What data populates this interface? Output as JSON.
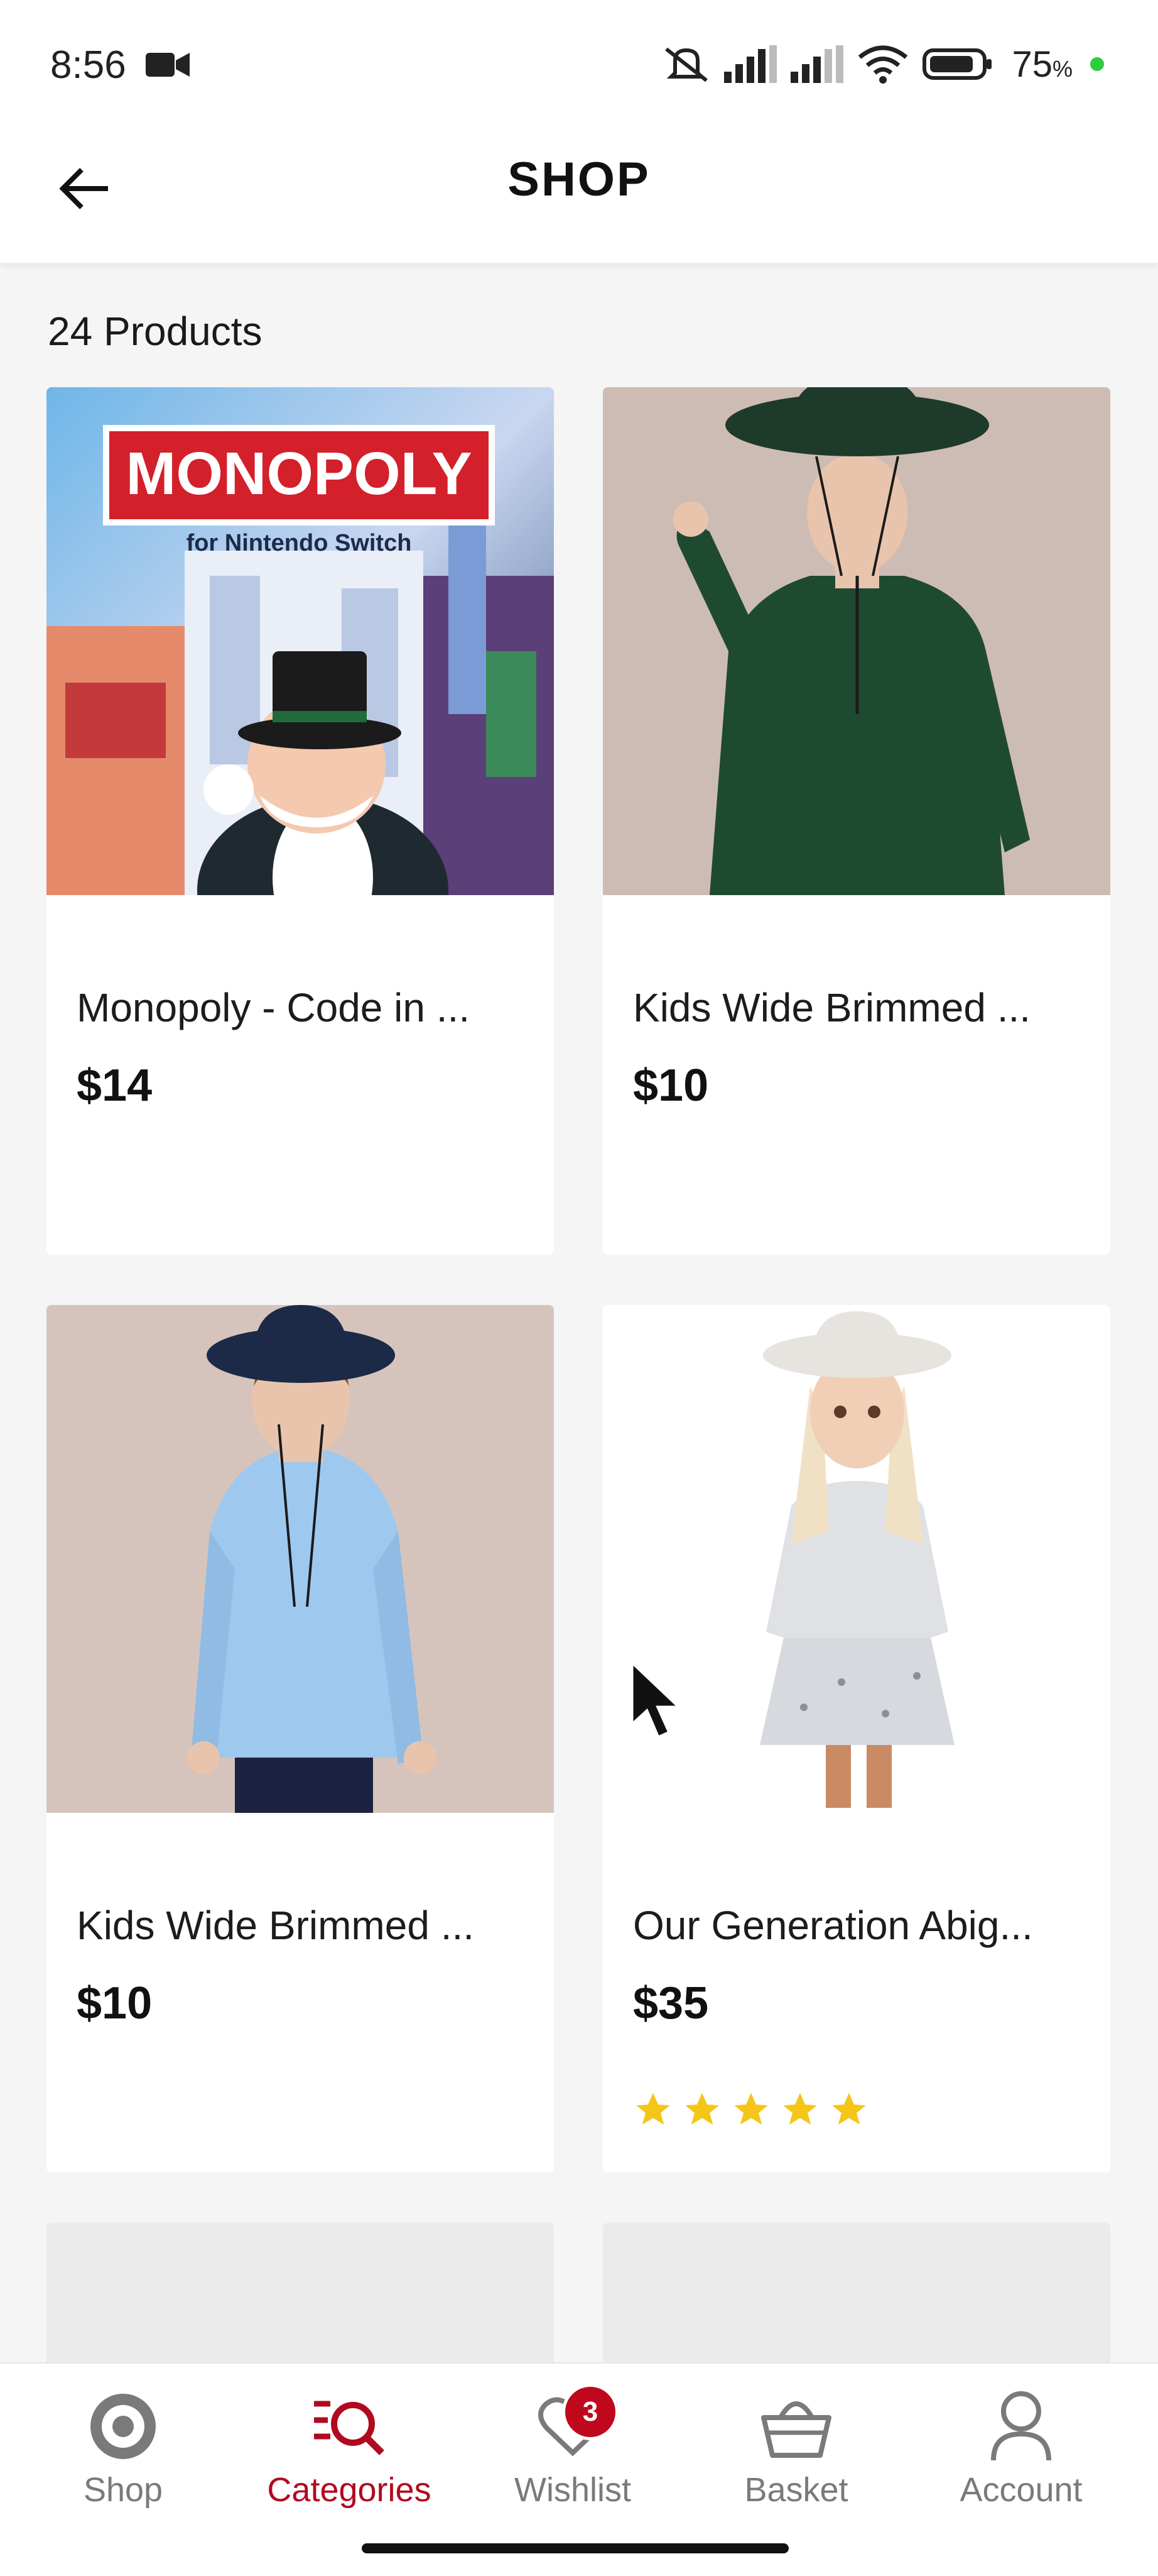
{
  "status": {
    "time": "8:56",
    "battery": "75",
    "battery_unit": "%",
    "icons": [
      "video-camera-icon",
      "mute-icon",
      "signal-icon",
      "signal-icon",
      "wifi-icon",
      "battery-icon"
    ]
  },
  "header": {
    "title": "SHOP",
    "back_icon": "arrow-left-icon"
  },
  "products_count": "24 Products",
  "products": [
    {
      "name": "Monopoly - Code in ...",
      "price": "$14",
      "rating": null,
      "image": "monopoly-nintendo-switch-cover"
    },
    {
      "name": "Kids Wide Brimmed ...",
      "price": "$10",
      "rating": null,
      "image": "kid-green-shirt-wide-hat"
    },
    {
      "name": "Kids Wide Brimmed ...",
      "price": "$10",
      "rating": null,
      "image": "kid-blue-shirt-wide-hat"
    },
    {
      "name": "Our Generation Abig...",
      "price": "$35",
      "rating": 5,
      "image": "doll-white-hat"
    }
  ],
  "nav": [
    {
      "label": "Shop",
      "icon": "target-icon",
      "active": false
    },
    {
      "label": "Categories",
      "icon": "categories-search-icon",
      "active": true
    },
    {
      "label": "Wishlist",
      "icon": "heart-icon",
      "active": false,
      "badge": "3"
    },
    {
      "label": "Basket",
      "icon": "basket-icon",
      "active": false
    },
    {
      "label": "Account",
      "icon": "person-icon",
      "active": false
    }
  ],
  "colors": {
    "accent": "#b10a1e",
    "badge": "#c0081c",
    "star": "#f5c518",
    "background": "#f5f5f6"
  }
}
